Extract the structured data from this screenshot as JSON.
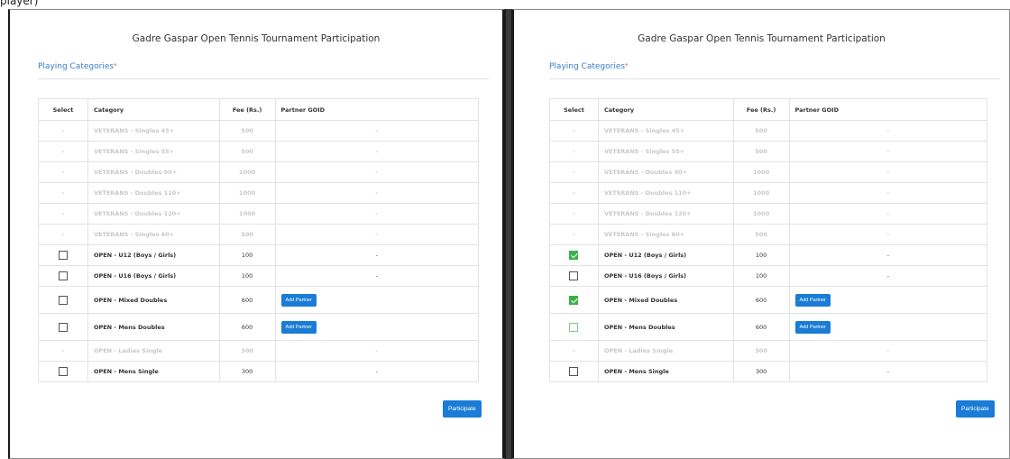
{
  "caption": "player)",
  "form": {
    "title": "Gadre Gaspar Open Tennis Tournament Participation",
    "section_label": "Playing Categories",
    "required_mark": "*",
    "columns": [
      "Select",
      "Category",
      "Fee (Rs.)",
      "Partner GOID"
    ],
    "add_partner_label": "Add Partner",
    "participate_label": "Participate",
    "disabled_select": "-",
    "rows": [
      {
        "name": "VETERANS - Singles 45+",
        "fee": "500",
        "partner": "-",
        "enabled": false
      },
      {
        "name": "VETERANS - Singles 55+",
        "fee": "500",
        "partner": "-",
        "enabled": false
      },
      {
        "name": "VETERANS - Doubles 90+",
        "fee": "1000",
        "partner": "-",
        "enabled": false
      },
      {
        "name": "VETERANS - Doubles 110+",
        "fee": "1000",
        "partner": "-",
        "enabled": false
      },
      {
        "name": "VETERANS - Doubles 120+",
        "fee": "1000",
        "partner": "-",
        "enabled": false
      },
      {
        "name": "VETERANS - Singles 60+",
        "fee": "500",
        "partner": "-",
        "enabled": false
      },
      {
        "name": "OPEN - U12 (Boys / Girls)",
        "fee": "100",
        "partner": "-",
        "enabled": true
      },
      {
        "name": "OPEN - U16 (Boys / Girls)",
        "fee": "100",
        "partner": "-",
        "enabled": true
      },
      {
        "name": "OPEN - Mixed Doubles",
        "fee": "600",
        "partner": "",
        "enabled": true
      },
      {
        "name": "OPEN - Mens Doubles",
        "fee": "600",
        "partner": "",
        "enabled": true
      },
      {
        "name": "OPEN - Ladies Single",
        "fee": "300",
        "partner": "-",
        "enabled": false
      },
      {
        "name": "OPEN - Mens Single",
        "fee": "300",
        "partner": "-",
        "enabled": true
      }
    ]
  },
  "colors": {
    "accent": "#1a7cd6",
    "check_green": "#3cb04a",
    "label_blue": "#3a7fc8",
    "disabled_text": "#c8c8c8"
  }
}
